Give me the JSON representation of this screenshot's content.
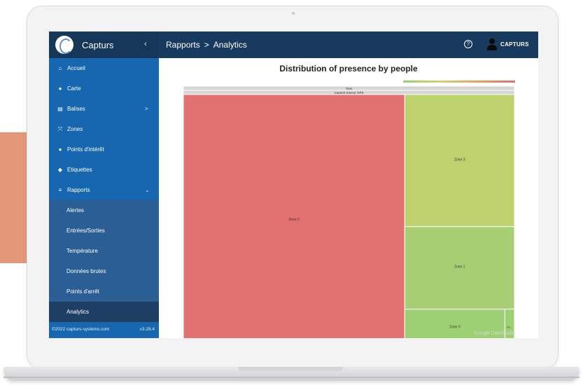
{
  "app": {
    "name": "Capturs",
    "collapse_icon": "chevron-left-icon",
    "footer_copyright": "©2022 capturs-systems.com",
    "footer_version": "v3.28.4"
  },
  "topbar": {
    "breadcrumb_root": "Rapports",
    "breadcrumb_sep": ">",
    "breadcrumb_current": "Analytics",
    "help_label": "?",
    "user_name": "CAPTURS"
  },
  "sidebar": {
    "items": [
      {
        "label": "Accueil",
        "icon": "home-icon",
        "glyph": "⌂"
      },
      {
        "label": "Carte",
        "icon": "map-pin-icon",
        "glyph": "●"
      },
      {
        "label": "Balises",
        "icon": "device-icon",
        "glyph": "▤",
        "chevron": ">"
      },
      {
        "label": "Zones",
        "icon": "zones-icon",
        "glyph": "⤧"
      },
      {
        "label": "Points d'intérêt",
        "icon": "poi-pin-icon",
        "glyph": "●"
      },
      {
        "label": "Etiquettes",
        "icon": "tag-icon",
        "glyph": "◆"
      },
      {
        "label": "Rapports",
        "icon": "list-icon",
        "glyph": "≡",
        "chevron": "⌄"
      }
    ],
    "sub_items": [
      {
        "label": "Alertes"
      },
      {
        "label": "Entrées/Sorties"
      },
      {
        "label": "Température"
      },
      {
        "label": "Données brutes"
      },
      {
        "label": "Points d'arrêt"
      },
      {
        "label": "Analytics"
      }
    ]
  },
  "chart": {
    "title": "Distribution of presence by people",
    "watermark": "Google DataStudio"
  },
  "chart_data": {
    "type": "treemap",
    "title": "Distribution of presence by people",
    "levels": [
      "Tous",
      "Capture traceur GPS"
    ],
    "colors": {
      "Zone 2": "#e27171",
      "Zone 3": "#bdd26c",
      "Zone 1": "#a9cf74",
      "Zone 0": "#9dd072",
      "Zo...": "#9dd072",
      "header": "#d6d6d6"
    },
    "leaves": [
      {
        "name": "Zone 2",
        "value": 335
      },
      {
        "name": "Zone 3",
        "value": 88
      },
      {
        "name": "Zone 1",
        "value": 55
      },
      {
        "name": "Zone 0",
        "value": 21
      },
      {
        "name": "Zo...",
        "value": 2
      }
    ]
  }
}
